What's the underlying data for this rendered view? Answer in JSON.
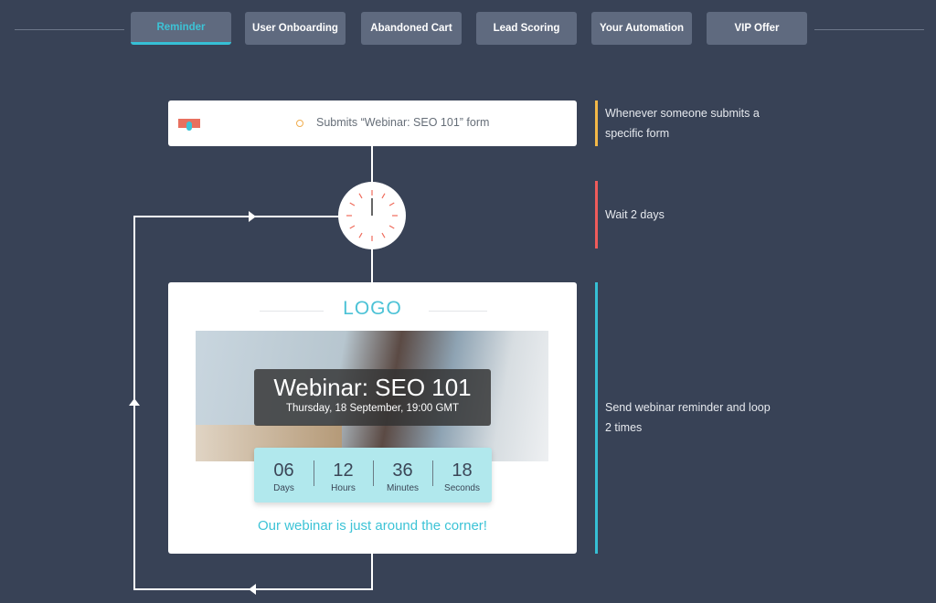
{
  "tabs": [
    {
      "label": "Reminder",
      "active": true
    },
    {
      "label": "User Onboarding"
    },
    {
      "label": "Abandoned Cart"
    },
    {
      "label": "Lead Scoring"
    },
    {
      "label": "Your Automation"
    },
    {
      "label": "VIP Offer"
    }
  ],
  "trigger": {
    "text": "Submits “Webinar: SEO 101” form",
    "icon": "form-click-icon"
  },
  "wait": {
    "icon": "clock-icon"
  },
  "email": {
    "logo": "LOGO",
    "title": "Webinar: SEO 101",
    "date": "Thursday, 18 September, 19:00 GMT",
    "countdown": [
      {
        "value": "06",
        "unit": "Days"
      },
      {
        "value": "12",
        "unit": "Hours"
      },
      {
        "value": "36",
        "unit": "Minutes"
      },
      {
        "value": "18",
        "unit": "Seconds"
      }
    ],
    "tagline": "Our webinar is just around the corner!"
  },
  "steps": [
    {
      "text": "Whenever someone submits a specific form",
      "color": "#f3b847"
    },
    {
      "text": "Wait 2 days",
      "color": "#ef5b5b"
    },
    {
      "text": "Send webinar reminder and loop 2 times",
      "color": "#36bfd4"
    }
  ],
  "colors": {
    "background": "#384256",
    "accent": "#36c0d6"
  }
}
